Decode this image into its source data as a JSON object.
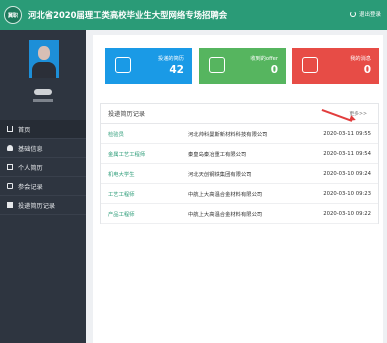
{
  "header": {
    "logo_text": "冀职",
    "title": "河北省2020届理工类高校毕业生大型网络专场招聘会",
    "logout_label": "退出登录"
  },
  "colors": {
    "header": "#2a9b77",
    "sidebar": "#2e3540",
    "card_resumes": "#1a9ae6",
    "card_offers": "#56b55f",
    "card_messages": "#e74c46",
    "link": "#2a9b77",
    "annotation_arrow": "#e23d3d"
  },
  "sidebar": {
    "items": [
      {
        "label": "首页",
        "icon": "home-icon",
        "active": true
      },
      {
        "label": "基础信息",
        "icon": "user-icon",
        "active": false
      },
      {
        "label": "个人简历",
        "icon": "document-icon",
        "active": false
      },
      {
        "label": "参会记录",
        "icon": "chair-icon",
        "active": false
      },
      {
        "label": "投递简历记录",
        "icon": "list-icon",
        "active": false
      }
    ]
  },
  "stats": [
    {
      "label": "投递的简历",
      "value": "42",
      "icon": "resume-icon"
    },
    {
      "label": "收到的offer",
      "value": "0",
      "icon": "mail-icon"
    },
    {
      "label": "我的消息",
      "value": "0",
      "icon": "message-icon"
    }
  ],
  "records": {
    "title": "投递简历记录",
    "more_label": "更多>>",
    "rows": [
      {
        "position": "检验员",
        "company": "河北帅科曼斯新材料科技有限公司",
        "time": "2020-03-11 09:55"
      },
      {
        "position": "金属工艺工程师",
        "company": "秦皇岛秦冶重工有限公司",
        "time": "2020-03-11 09:54"
      },
      {
        "position": "机电大学生",
        "company": "河北天创钢铁集团有限公司",
        "time": "2020-03-10 09:24"
      },
      {
        "position": "工艺工程师",
        "company": "中航上大高温合金材料有限公司",
        "time": "2020-03-10 09:23"
      },
      {
        "position": "产品工程师",
        "company": "中航上大高温合金材料有限公司",
        "time": "2020-03-10 09:22"
      }
    ]
  }
}
